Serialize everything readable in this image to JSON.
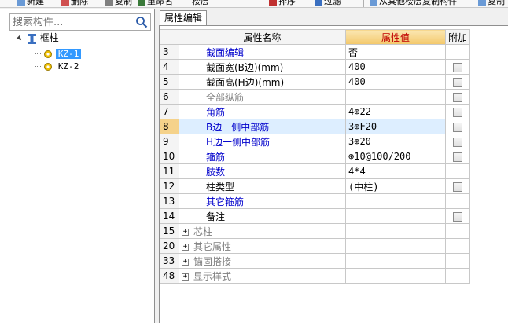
{
  "toolbar": {
    "items": [
      "新建",
      "删除",
      "复制",
      "重命名",
      "楼层",
      "排序",
      "过滤",
      "从其他楼层复制构件",
      "复制"
    ]
  },
  "left": {
    "search": {
      "placeholder": "搜索构件...",
      "value": ""
    },
    "tree": {
      "root": "框柱",
      "children": [
        "KZ-1",
        "KZ-2"
      ],
      "selected": "KZ-1"
    }
  },
  "right": {
    "tab": "属性编辑",
    "headers": {
      "name": "属性名称",
      "value": "属性值",
      "add": "附加"
    },
    "rows": [
      {
        "num": "3",
        "name": "截面编辑",
        "value": "否",
        "style": "blue",
        "checkbox": false
      },
      {
        "num": "4",
        "name": "截面宽(B边)(mm)",
        "value": "400",
        "style": "black",
        "checkbox": true
      },
      {
        "num": "5",
        "name": "截面高(H边)(mm)",
        "value": "400",
        "style": "black",
        "checkbox": true
      },
      {
        "num": "6",
        "name": "全部纵筋",
        "value": "",
        "style": "gray",
        "checkbox": true
      },
      {
        "num": "7",
        "name": "角筋",
        "value": "4⊕22",
        "style": "blue",
        "checkbox": true
      },
      {
        "num": "8",
        "name": "B边一侧中部筋",
        "value": "3⊕F20",
        "style": "blue",
        "checkbox": true,
        "selected": true
      },
      {
        "num": "9",
        "name": "H边一侧中部筋",
        "value": "3⊕20",
        "style": "blue",
        "checkbox": true
      },
      {
        "num": "10",
        "name": "箍筋",
        "value": "⊕10@100/200",
        "style": "blue",
        "checkbox": true
      },
      {
        "num": "11",
        "name": "肢数",
        "value": "4*4",
        "style": "blue",
        "checkbox": false
      },
      {
        "num": "12",
        "name": "柱类型",
        "value": "(中柱)",
        "style": "black",
        "checkbox": true
      },
      {
        "num": "13",
        "name": "其它箍筋",
        "value": "",
        "style": "blue",
        "checkbox": false
      },
      {
        "num": "14",
        "name": "备注",
        "value": "",
        "style": "black",
        "checkbox": true
      },
      {
        "num": "15",
        "name": "芯柱",
        "value": "",
        "style": "gray",
        "checkbox": false,
        "expandable": true
      },
      {
        "num": "20",
        "name": "其它属性",
        "value": "",
        "style": "gray",
        "checkbox": false,
        "expandable": true
      },
      {
        "num": "33",
        "name": "锚固搭接",
        "value": "",
        "style": "gray",
        "checkbox": false,
        "expandable": true
      },
      {
        "num": "48",
        "name": "显示样式",
        "value": "",
        "style": "gray",
        "checkbox": false,
        "expandable": true
      }
    ]
  },
  "colors": {
    "selection": "#3399ff",
    "value_header": "#f3c86b",
    "value_header_text": "#c00000",
    "blue_text": "#0000cc",
    "gray_text": "#808080",
    "active_row_num": "#f5d28a"
  }
}
